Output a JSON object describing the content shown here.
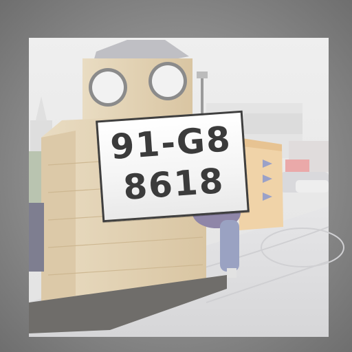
{
  "scene": {
    "description_free": true,
    "colors": {
      "outer_frame": "#8d8d8d",
      "sky": "#ececec",
      "tower_stone": "#e6d6b8",
      "tower_shadow": "#d8c3a0",
      "booth_orange": "#f0d3a8",
      "pavement": "#e2e2e4",
      "plate_border": "#3f3f3f",
      "plate_text": "#3b3b3b"
    }
  },
  "plate": {
    "line1": "91-G8",
    "line2": "8618"
  }
}
